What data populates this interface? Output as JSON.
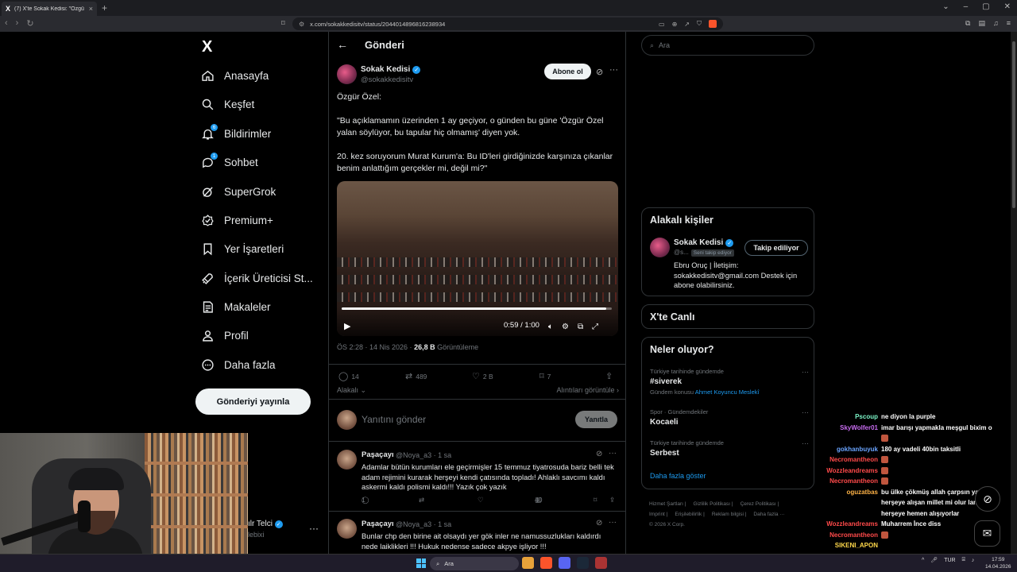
{
  "browser": {
    "tab_title": "(7) X'te Sokak Kedisi: \"Özgür Öz...",
    "tab_favicon": "x-icon",
    "url": "x.com/sokakkedisitv/status/2044014896816238934"
  },
  "nav": {
    "logo": "X",
    "items": [
      {
        "label": "Anasayfa",
        "icon": "home-icon"
      },
      {
        "label": "Keşfet",
        "icon": "search-icon"
      },
      {
        "label": "Bildirimler",
        "icon": "bell-icon",
        "badge": "6"
      },
      {
        "label": "Sohbet",
        "icon": "chat-icon",
        "badge": "1"
      },
      {
        "label": "SuperGrok",
        "icon": "grok-icon"
      },
      {
        "label": "Premium+",
        "icon": "premium-icon"
      },
      {
        "label": "Yer İşaretleri",
        "icon": "bookmark-icon"
      },
      {
        "label": "İçerik Üreticisi St...",
        "icon": "rocket-icon"
      },
      {
        "label": "Makaleler",
        "icon": "article-icon"
      },
      {
        "label": "Profil",
        "icon": "person-icon"
      },
      {
        "label": "Daha fazla",
        "icon": "more-circle-icon"
      }
    ],
    "post_button": "Gönderiyi yayınla",
    "account_name": "ılr Telci",
    "account_handle": "lebixi"
  },
  "main": {
    "title": "Gönderi",
    "author": {
      "name": "Sokak Kedisi",
      "handle": "@sokakkedisitv",
      "subscribe": "Abone ol"
    },
    "tweet_paragraphs": [
      "Özgür Özel:",
      "\"Bu açıklamamın üzerinden 1 ay geçiyor, o günden bu güne 'Özgür Özel yalan söylüyor, bu tapular hiç olmamış' diyen yok.",
      "20. kez soruyorum Murat Kurum'a: Bu ID'leri girdiğinizde karşınıza çıkanlar benim anlattığım gerçekler mi, değil mi?\""
    ],
    "video": {
      "time": "0:59 / 1:00",
      "progress": 0.98
    },
    "meta": {
      "time": "ÖS 2:28 · 14 Nis 2026 ·",
      "views": "26,8 B",
      "views_label": "Görüntüleme"
    },
    "actions": {
      "replies": "14",
      "reposts": "489",
      "likes": "2 B",
      "bookmarks": "7"
    },
    "relevant_label": "Alakalı",
    "quotes_label": "Alıntıları görüntüle",
    "reply_placeholder": "Yanıtını gönder",
    "reply_button": "Yanıtla",
    "replies": [
      {
        "name": "Paşaçayı",
        "handle": "@Noya_a3 · 1 sa",
        "text": "Adamlar bütün kurumları ele geçirmişler 15 temmuz tiyatrosuda bariz belli tek adam rejimini kurarak herşeyi kendi çatısında topladı! Ahlaklı savcımı kaldı askermi kaldı polismi kaldı!!! Yazık çok yazık",
        "replies": "1",
        "views": "40"
      },
      {
        "name": "Paşaçayı",
        "handle": "@Noya_a3 · 1 sa",
        "text": "Bunlar chp den birine ait olsaydı yer gök inler ne namussuzlukları kaldırdı nede laiklikleri !!! Hukuk nedense sadece akpye işliyor !!!",
        "replies": "",
        "views": ""
      }
    ]
  },
  "right": {
    "search_placeholder": "Ara",
    "relevant_people_title": "Alakalı kişiler",
    "person": {
      "name": "Sokak Kedisi",
      "handle": "@s...",
      "follows_you": "Seni takip ediyor",
      "follow_button": "Takip ediliyor",
      "bio": "Ebru Oruç | İletişim: sokakkedisitv@gmail.com Destek için abone olabilirsiniz."
    },
    "live_title": "X'te Canlı",
    "trends_title": "Neler oluyor?",
    "trends": [
      {
        "context": "Türkiye tarihinde gündemde",
        "name": "#siverek",
        "sub": "Gündem konusu",
        "sub_link": "Ahmet Koyuncu Meslekî"
      },
      {
        "context": "Spor · Gündemdekiler",
        "name": "Kocaeli",
        "sub": "",
        "sub_link": ""
      },
      {
        "context": "Türkiye tarihinde gündemde",
        "name": "Serbest",
        "sub": "",
        "sub_link": ""
      }
    ],
    "show_more": "Daha fazla göster",
    "footer": [
      "Hizmet Şartları |",
      "Gizlilik Politikası |",
      "Çerez Politikası |",
      "Imprint |",
      "Erişilebilirlik |",
      "Reklam bilgisi |",
      "Daha fazla ···",
      "© 2026 X Corp."
    ]
  },
  "chat": [
    {
      "user": "Pscoup",
      "color": "#7cf5c8",
      "text": "ne diyon la purple"
    },
    {
      "user": "SkyWolfer01",
      "color": "#c86cf0",
      "text": "imar barışı yapmakla meşgul bixim o"
    },
    {
      "user": "",
      "color": "#ffffff",
      "text": "",
      "emote": true
    },
    {
      "user": "gokhanbuyuk",
      "color": "#6aa4ff",
      "text": "180 ay vadeli 40bin taksitli"
    },
    {
      "user": "Necromantheon",
      "color": "#ff4a4a",
      "text": "",
      "emote": true
    },
    {
      "user": "Wozzleandreams",
      "color": "#ff4a4a",
      "text": "",
      "emote": true
    },
    {
      "user": "Necromantheon",
      "color": "#ff4a4a",
      "text": "",
      "emote": true
    },
    {
      "user": "oguzatbas",
      "color": "#ffb347",
      "text": "bu ülke çökmüş allah çarpsın ya"
    },
    {
      "user": "",
      "color": "#ffffff",
      "text": "herşeye alışan millet mi olur lank"
    },
    {
      "user": "",
      "color": "#ffffff",
      "text": "herşeye hemen alışıyorlar"
    },
    {
      "user": "Wozzleandreams",
      "color": "#ff4a4a",
      "text": "Muharrem İnce diss"
    },
    {
      "user": "Necromantheon",
      "color": "#ff4a4a",
      "text": "",
      "emote": true
    },
    {
      "user": "SIKENI_APON",
      "color": "#ffd84a",
      "text": ""
    }
  ],
  "taskbar": {
    "search_placeholder": "Ara",
    "lang": "TUR",
    "time": "17:59",
    "date": "14.04.2026"
  }
}
